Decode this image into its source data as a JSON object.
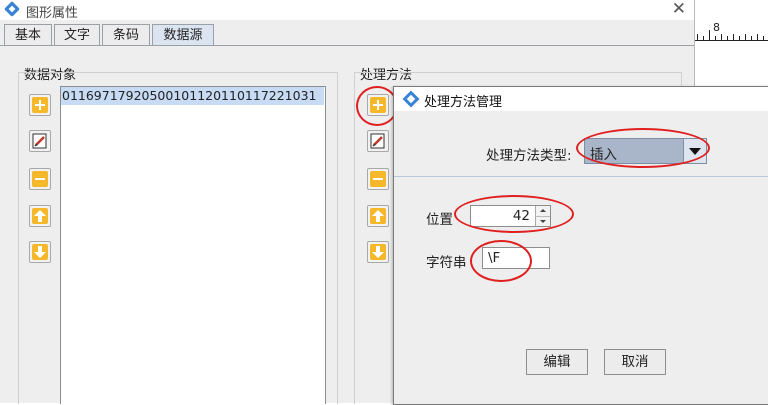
{
  "window": {
    "title": "图形属性",
    "tabs": [
      "基本",
      "文字",
      "条码",
      "数据源"
    ],
    "active_tab": "数据源"
  },
  "data_object": {
    "label": "数据对象",
    "selected_item": "01169717920500101120110117221031"
  },
  "processing": {
    "label": "处理方法"
  },
  "ruler": {
    "number": "8"
  },
  "dialog": {
    "title": "处理方法管理",
    "type_label": "处理方法类型:",
    "type_value": "插入",
    "position_label": "位置",
    "position_value": "42",
    "string_label": "字符串",
    "string_value": "\\F",
    "edit_button": "编辑",
    "cancel_button": "取消"
  },
  "colors": {
    "annotation": "#e02020",
    "selection": "#c7dcf4",
    "combo": "#a9b6c9"
  },
  "icons": [
    "add-icon",
    "edit-icon",
    "remove-icon",
    "move-up-icon",
    "move-down-icon",
    "close-icon"
  ]
}
